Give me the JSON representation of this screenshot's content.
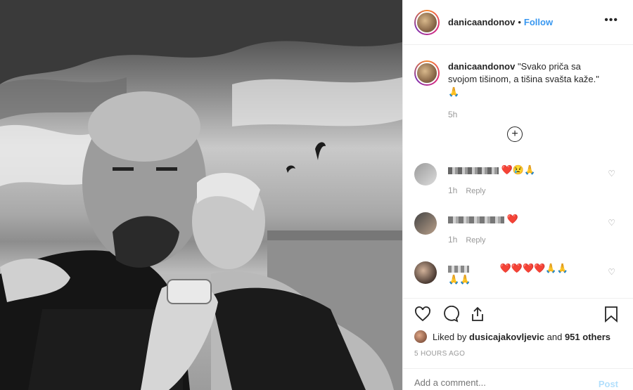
{
  "post": {
    "username": "danicaandonov",
    "separator": "•",
    "follow_label": "Follow",
    "more_icon": "•••",
    "caption_text": "\"Svako priča sa svojom tišinom, a tišina svašta kaže.\"",
    "caption_emoji": "🙏",
    "caption_time": "5h",
    "load_more_icon": "+"
  },
  "comments": [
    {
      "emojis": "❤️😢🙏",
      "time": "1h",
      "reply": "Reply"
    },
    {
      "emojis": "❤️",
      "time": "1h",
      "reply": "Reply"
    },
    {
      "emojis": "❤️❤️❤️❤️🙏🙏",
      "emojis2": "🙏🙏"
    }
  ],
  "likes": {
    "prefix": "Liked by",
    "user": "dusicajakovljevic",
    "and": "and",
    "others": "951 others"
  },
  "timestamp": "5 HOURS AGO",
  "comment_box": {
    "placeholder": "Add a comment...",
    "post_label": "Post"
  },
  "colors": {
    "link": "#3897f0",
    "muted": "#999999",
    "post_disabled": "#b2dffc"
  }
}
